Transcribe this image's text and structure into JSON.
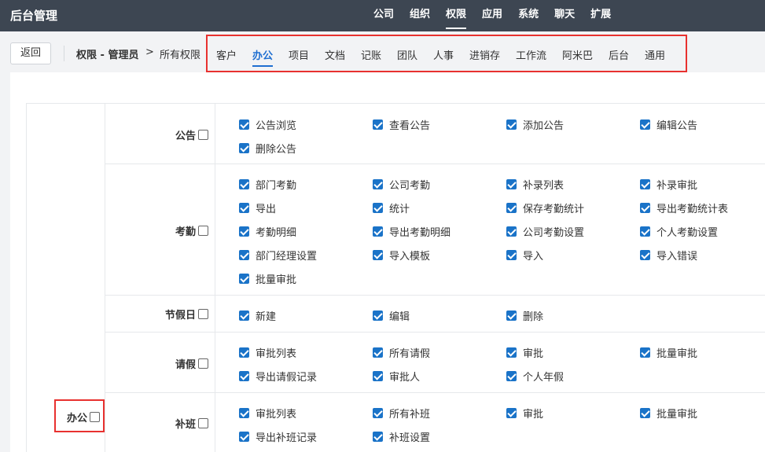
{
  "app": {
    "title": "后台管理"
  },
  "topnav": [
    "公司",
    "组织",
    "权限",
    "应用",
    "系统",
    "聊天",
    "扩展"
  ],
  "topnav_active": "权限",
  "subbar": {
    "back_label": "返回",
    "crumb_main": "权限 - 管理员",
    "crumb_arrow": ">",
    "crumb_all": "所有权限"
  },
  "tabs": [
    "客户",
    "办公",
    "项目",
    "文档",
    "记账",
    "团队",
    "人事",
    "进销存",
    "工作流",
    "阿米巴",
    "后台",
    "通用"
  ],
  "tabs_active": "办公",
  "group": {
    "label": "办公"
  },
  "rows": [
    {
      "label": "公告",
      "items": [
        "公告浏览",
        "查看公告",
        "添加公告",
        "编辑公告",
        "删除公告"
      ]
    },
    {
      "label": "考勤",
      "items": [
        "部门考勤",
        "公司考勤",
        "补录列表",
        "补录审批",
        "导出",
        "统计",
        "保存考勤统计",
        "导出考勤统计表",
        "考勤明细",
        "导出考勤明细",
        "公司考勤设置",
        "个人考勤设置",
        "部门经理设置",
        "导入模板",
        "导入",
        "导入错误",
        "批量审批"
      ]
    },
    {
      "label": "节假日",
      "items": [
        "新建",
        "编辑",
        "删除"
      ]
    },
    {
      "label": "请假",
      "items": [
        "审批列表",
        "所有请假",
        "审批",
        "批量审批",
        "导出请假记录",
        "审批人",
        "个人年假"
      ]
    },
    {
      "label": "补班",
      "items": [
        "审批列表",
        "所有补班",
        "审批",
        "批量审批",
        "导出补班记录",
        "补班设置"
      ]
    }
  ],
  "colors": {
    "topbar": "#3d4652",
    "accent": "#1f6fd1",
    "checkbox": "#1a73c8",
    "highlight_border": "#e8312f"
  }
}
